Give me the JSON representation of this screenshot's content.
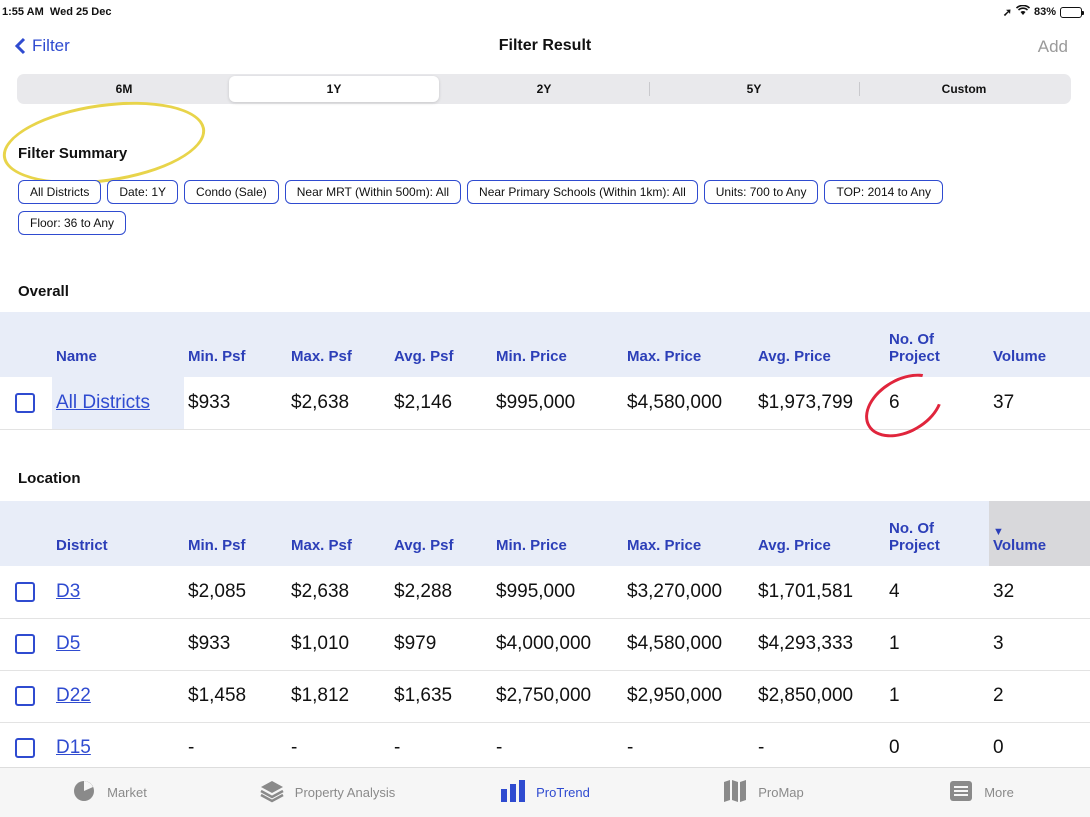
{
  "status": {
    "time": "1:55 AM",
    "date": "Wed 25 Dec",
    "battery": "83%",
    "battery_level": 0.83
  },
  "nav": {
    "back_label": "Filter",
    "title": "Filter Result",
    "add_label": "Add"
  },
  "periods": [
    {
      "label": "6M",
      "active": false
    },
    {
      "label": "1Y",
      "active": true
    },
    {
      "label": "2Y",
      "active": false
    },
    {
      "label": "5Y",
      "active": false
    },
    {
      "label": "Custom",
      "active": false
    }
  ],
  "filter_summary": {
    "title": "Filter Summary",
    "chips": [
      "All Districts",
      "Date: 1Y",
      "Condo (Sale)",
      "Near MRT (Within 500m): All",
      "Near Primary Schools (Within 1km): All",
      "Units: 700 to Any",
      "TOP: 2014 to Any",
      "Floor: 36 to Any"
    ]
  },
  "overall": {
    "title": "Overall",
    "headers": [
      "Name",
      "Min. Psf",
      "Max. Psf",
      "Avg. Psf",
      "Min. Price",
      "Max. Price",
      "Avg. Price",
      "No. Of Project",
      "Volume"
    ],
    "row": [
      "All Districts",
      "$933",
      "$2,638",
      "$2,146",
      "$995,000",
      "$4,580,000",
      "$1,973,799",
      "6",
      "37"
    ]
  },
  "location": {
    "title": "Location",
    "headers": [
      "District",
      "Min. Psf",
      "Max. Psf",
      "Avg. Psf",
      "Min. Price",
      "Max. Price",
      "Avg. Price",
      "No. Of Project",
      "Volume"
    ],
    "sort_indicator": "▼",
    "rows": [
      [
        "D3",
        "$2,085",
        "$2,638",
        "$2,288",
        "$995,000",
        "$3,270,000",
        "$1,701,581",
        "4",
        "32"
      ],
      [
        "D5",
        "$933",
        "$1,010",
        "$979",
        "$4,000,000",
        "$4,580,000",
        "$4,293,333",
        "1",
        "3"
      ],
      [
        "D22",
        "$1,458",
        "$1,812",
        "$1,635",
        "$2,750,000",
        "$2,950,000",
        "$2,850,000",
        "1",
        "2"
      ],
      [
        "D15",
        "-",
        "-",
        "-",
        "-",
        "-",
        "-",
        "0",
        "0"
      ]
    ]
  },
  "tabs": [
    {
      "label": "Market",
      "icon": "pie-chart-icon",
      "active": false
    },
    {
      "label": "Property Analysis",
      "icon": "layers-icon",
      "active": false
    },
    {
      "label": "ProTrend",
      "icon": "bar-chart-icon",
      "active": true
    },
    {
      "label": "ProMap",
      "icon": "map-icon",
      "active": false
    },
    {
      "label": "More",
      "icon": "list-icon",
      "active": false
    }
  ],
  "colors": {
    "accent": "#2f4bd0",
    "header_bg": "#e8edf8",
    "annotation_yellow": "#e8d44a",
    "annotation_red": "#e0253c"
  }
}
